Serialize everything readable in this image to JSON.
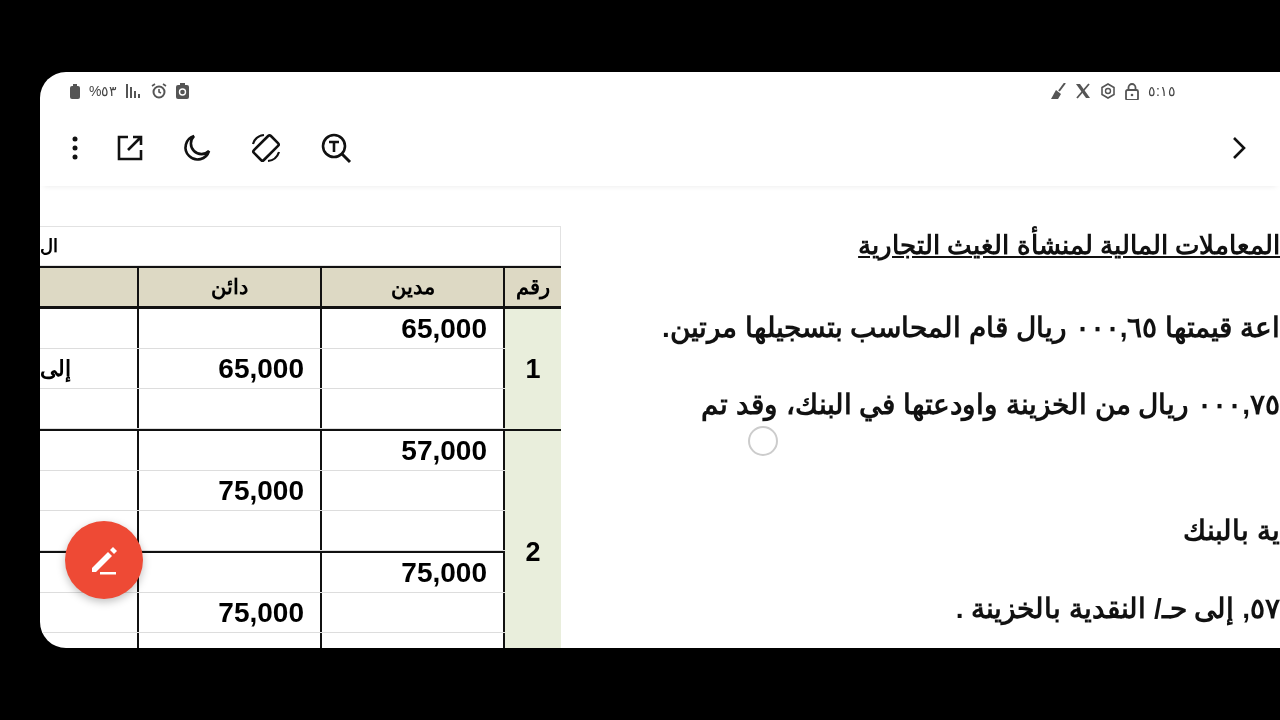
{
  "status_bar": {
    "battery": "%٥٣",
    "time": "٥:١٥"
  },
  "document": {
    "title": "المعاملات المالية لمنشأة الغيث التجارية",
    "lines": [
      "اعة قيمتها ٠٠٠,٦٥ ريال قام المحاسب بتسجيلها مرتين.",
      "٠٠٠,٧٥ ريال من الخزينة واودعتها في البنك، وقد تم",
      "ية بالبنك",
      "٥٧, إلى حـ/ النقدية بالخزينة ."
    ]
  },
  "table": {
    "caption": "ال",
    "columns": [
      "رقم",
      "مدين",
      "دائن"
    ],
    "groups": [
      {
        "number": "1",
        "blocks": [
          {
            "debit": "65,000",
            "credit": "65,000",
            "column_4": "إلى"
          }
        ]
      },
      {
        "number": "2",
        "blocks": [
          {
            "debit": "57,000",
            "credit": "75,000"
          },
          {
            "debit": "75,000",
            "credit": "75,000"
          }
        ]
      }
    ]
  }
}
